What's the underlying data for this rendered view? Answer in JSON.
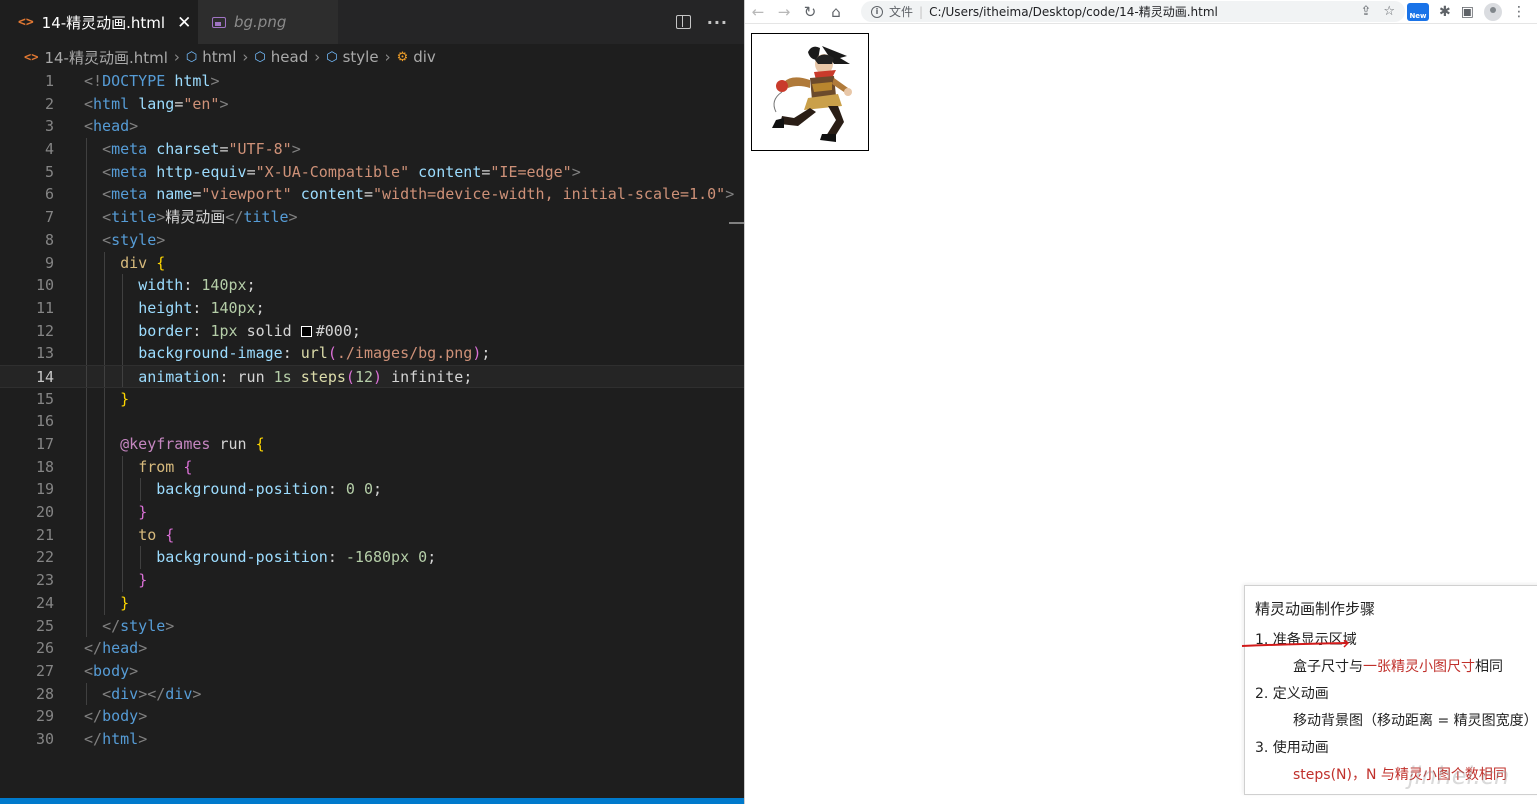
{
  "editor": {
    "tabs": [
      {
        "label": "14-精灵动画.html",
        "active": true
      },
      {
        "label": "bg.png",
        "active": false
      }
    ],
    "breadcrumb": [
      "14-精灵动画.html",
      "html",
      "head",
      "style",
      "div"
    ],
    "current_line": 14
  },
  "browser": {
    "secure_label": "文件",
    "url": "C:/Users/itheima/Desktop/code/14-精灵动画.html",
    "new_badge": "New"
  },
  "notes": {
    "title": "精灵动画制作步骤",
    "step1": "1. 准备显示区域",
    "step1_sub_prefix": "盒子尺寸与",
    "step1_sub_red": "一张精灵小图尺寸",
    "step1_sub_suffix": "相同",
    "step2": "2. 定义动画",
    "step2_sub": "移动背景图（移动距离 = 精灵图宽度）",
    "step3": "3. 使用动画",
    "step3_sub_red1": "steps(N)",
    "step3_sub_mid": "，N 与",
    "step3_sub_red2": "精灵小图个数",
    "step3_sub_suffix": "相同"
  },
  "watermark": "jinhei.cn",
  "colors": {
    "accent": "#007acc",
    "note_red": "#c0302b"
  }
}
